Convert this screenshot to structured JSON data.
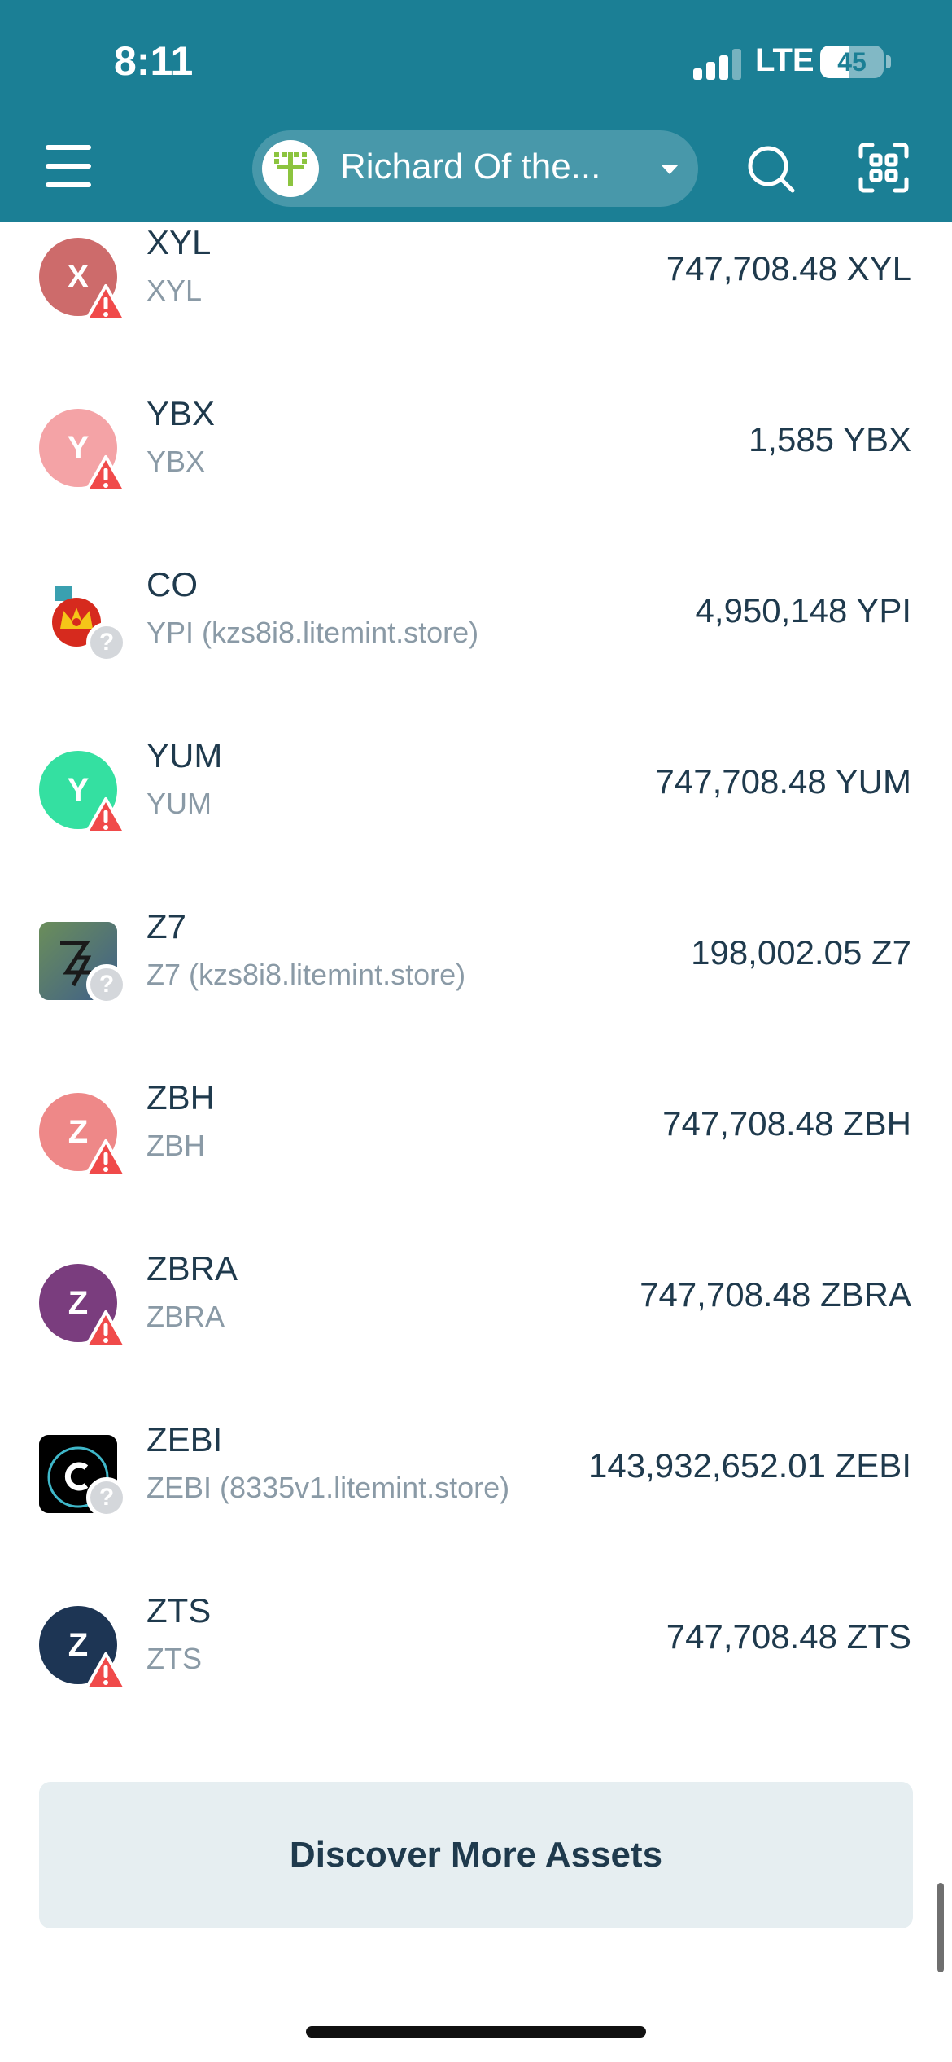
{
  "status_bar": {
    "time": "8:11",
    "network": "LTE",
    "battery_percent": "45",
    "battery_level": 0.45,
    "signal_bars": 3
  },
  "header": {
    "account_name": "Richard Of the...",
    "menu_icon": "hamburger-icon",
    "search_icon": "search-icon",
    "scan_icon": "qr-scan-icon",
    "background_color": "#1b7f95"
  },
  "assets": [
    {
      "icon_letter": "X",
      "icon_color": "#cd6b6b",
      "badge": "warning",
      "code": "XYL",
      "subtitle": "XYL",
      "balance": "747,708.48 XYL"
    },
    {
      "icon_letter": "Y",
      "icon_color": "#f4a3a6",
      "badge": "warning",
      "code": "YBX",
      "subtitle": "YBX",
      "balance": "1,585 YBX"
    },
    {
      "icon_letter": "",
      "icon_color": "#ffffff",
      "icon_image": "crown-logo",
      "badge": "unknown",
      "code": "CO",
      "subtitle": "YPI (kzs8i8.litemint.store)",
      "balance": "4,950,148 YPI"
    },
    {
      "icon_letter": "Y",
      "icon_color": "#34e0a1",
      "badge": "warning",
      "code": "YUM",
      "subtitle": "YUM",
      "balance": "747,708.48 YUM"
    },
    {
      "icon_letter": "",
      "icon_color": "#4f7a6a",
      "icon_image": "z7-logo",
      "badge": "unknown",
      "code": "Z7",
      "subtitle": "Z7 (kzs8i8.litemint.store)",
      "balance": "198,002.05 Z7"
    },
    {
      "icon_letter": "Z",
      "icon_color": "#ee8888",
      "badge": "warning",
      "code": "ZBH",
      "subtitle": "ZBH",
      "balance": "747,708.48 ZBH"
    },
    {
      "icon_letter": "Z",
      "icon_color": "#7a3d7e",
      "badge": "warning",
      "code": "ZBRA",
      "subtitle": "ZBRA",
      "balance": "747,708.48 ZBRA"
    },
    {
      "icon_letter": "",
      "icon_color": "#000000",
      "icon_image": "zebi-logo",
      "badge": "unknown",
      "code": "ZEBI",
      "subtitle": "ZEBI (8335v1.litemint.store)",
      "balance": "143,932,652.01 ZEBI"
    },
    {
      "icon_letter": "Z",
      "icon_color": "#1d3554",
      "badge": "warning",
      "code": "ZTS",
      "subtitle": "ZTS",
      "balance": "747,708.48 ZTS"
    }
  ],
  "discover_button": {
    "label": "Discover More Assets"
  },
  "colors": {
    "text": "#1f3a4d",
    "subtle_text": "#8a9aa6",
    "warning": "#f04a4a",
    "button_bg": "#e6eef1"
  }
}
